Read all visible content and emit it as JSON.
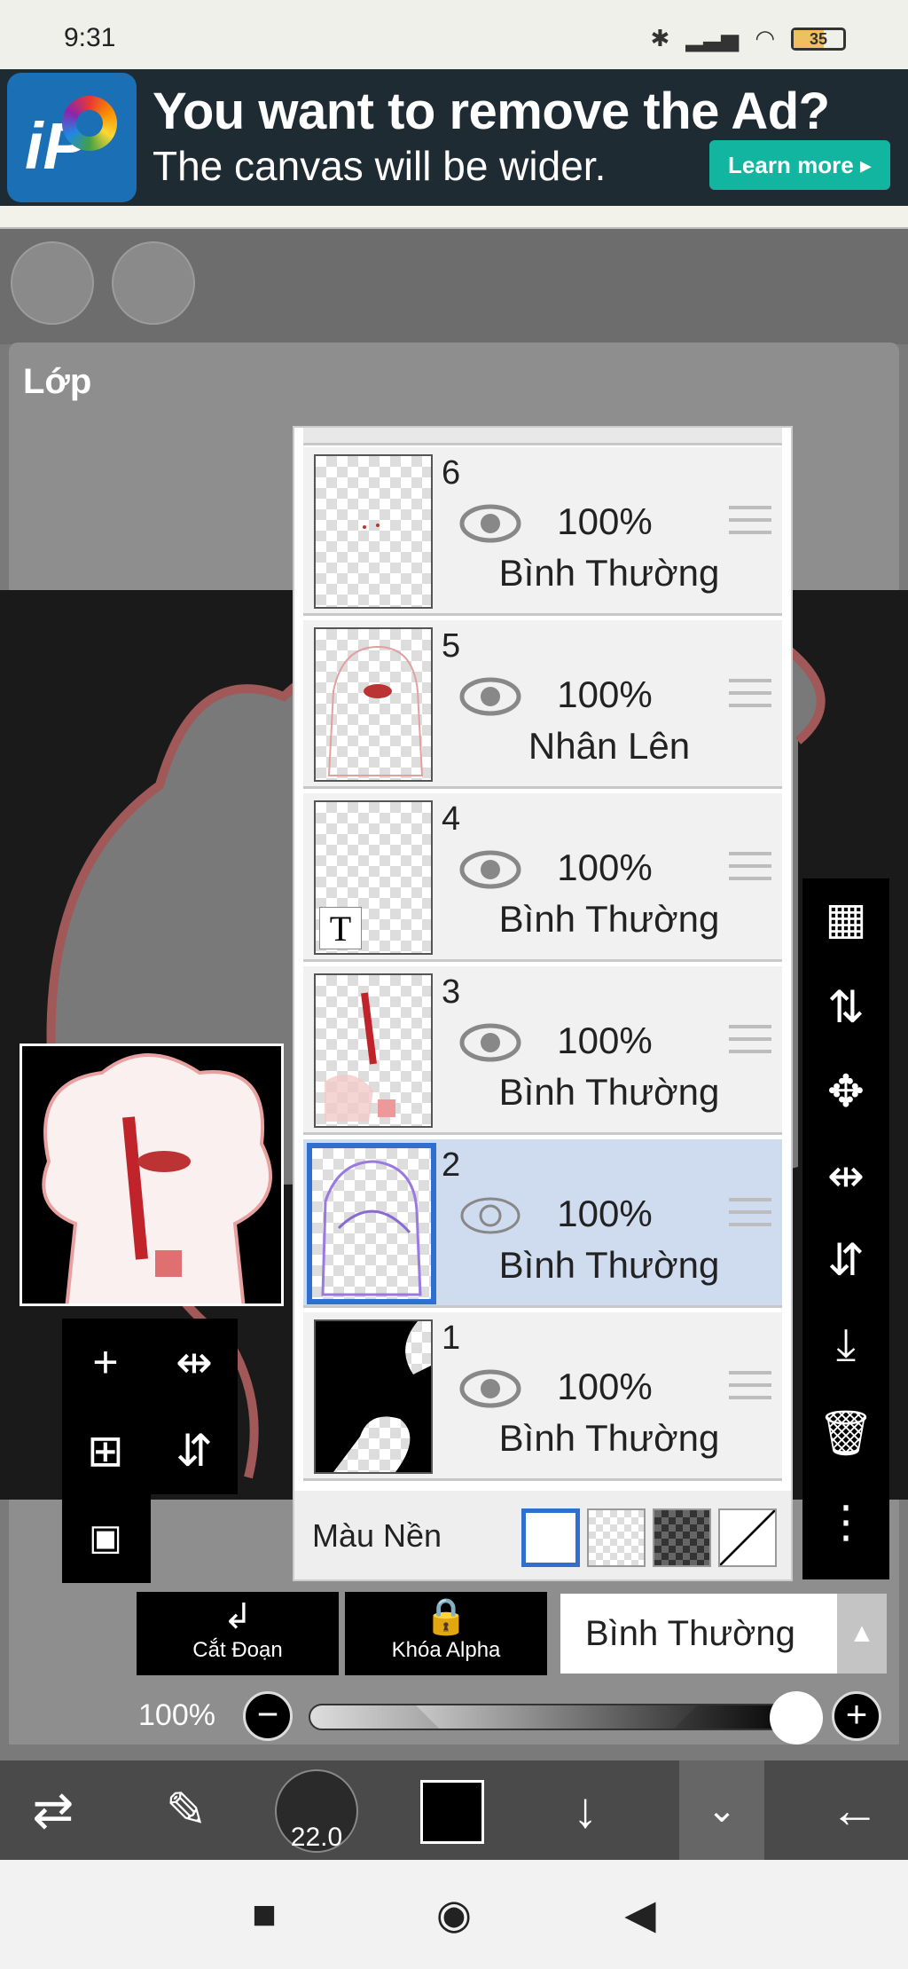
{
  "status_bar": {
    "time": "9:31",
    "battery": "35"
  },
  "ad": {
    "headline": "You want to remove the Ad?",
    "subline": "The canvas will be wider.",
    "cta": "Learn more ▸",
    "logo_text": "iP"
  },
  "layer_panel": {
    "title": "Lớp",
    "layers": [
      {
        "number": "6",
        "opacity": "100%",
        "blend": "Bình Thường",
        "visible": true,
        "selected": false
      },
      {
        "number": "5",
        "opacity": "100%",
        "blend": "Nhân Lên",
        "visible": true,
        "selected": false
      },
      {
        "number": "4",
        "opacity": "100%",
        "blend": "Bình Thường",
        "visible": true,
        "selected": false,
        "text_layer_glyph": "T"
      },
      {
        "number": "3",
        "opacity": "100%",
        "blend": "Bình Thường",
        "visible": true,
        "selected": false
      },
      {
        "number": "2",
        "opacity": "100%",
        "blend": "Bình Thường",
        "visible": true,
        "selected": true
      },
      {
        "number": "1",
        "opacity": "100%",
        "blend": "Bình Thường",
        "visible": true,
        "selected": false
      }
    ],
    "background_label": "Màu Nền"
  },
  "controls": {
    "clip_label": "Cắt Đoạn",
    "alpha_lock_label": "Khóa Alpha",
    "blend_mode": "Bình Thường",
    "opacity_label": "100%",
    "opacity_value": 1.0
  },
  "bottom_toolbar": {
    "brush_size": "22.0",
    "color": "#000000"
  },
  "icons": {
    "add_layer": "plus-icon",
    "camera": "camera-icon",
    "flip_h": "flip-horizontal-icon",
    "flip_v": "flip-vertical-icon",
    "checker": "transparency-icon",
    "move": "move-icon",
    "download": "merge-down-icon",
    "delete": "trash-icon",
    "more": "more-vertical-icon"
  },
  "accent_color": "#2e6fcf"
}
